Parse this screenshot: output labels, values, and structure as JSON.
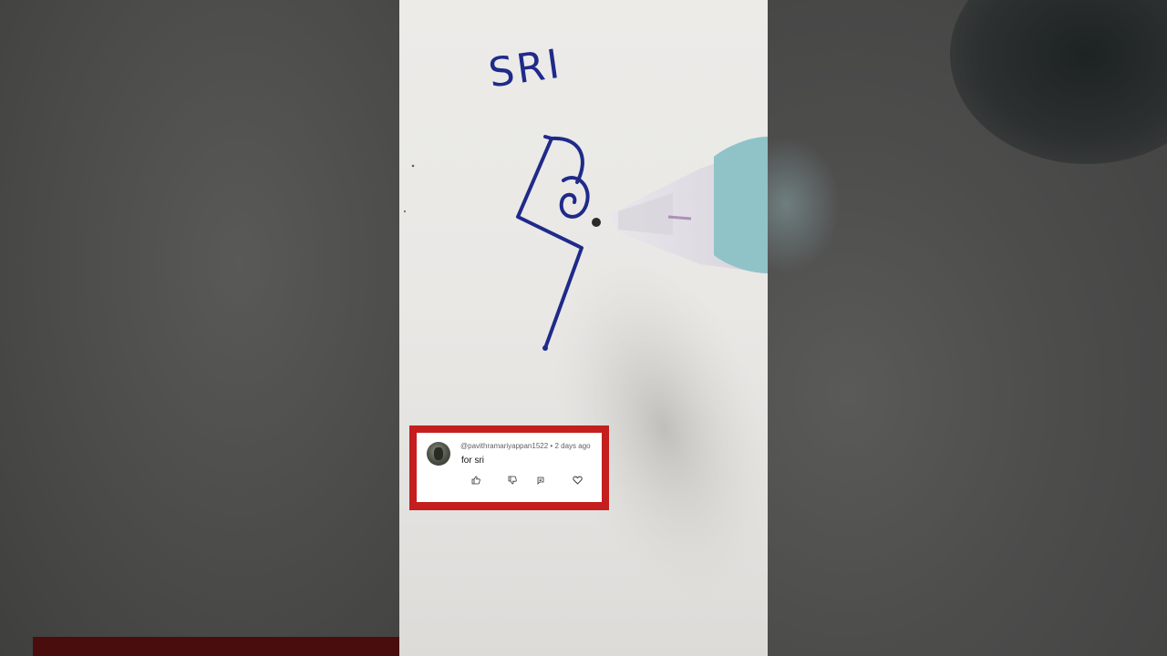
{
  "video": {
    "handwritten_text": "SRI"
  },
  "comment": {
    "username": "@pavithramariyappan1522",
    "separator": "•",
    "time_ago": "2 days ago",
    "text": "for sri",
    "actions": [
      "thumbs-up-icon",
      "thumbs-down-icon",
      "reply-icon",
      "heart-icon"
    ]
  },
  "colors": {
    "ink": "#1f2a8a",
    "frame": "#c41e1e",
    "pen_cap": "#8fc3c7"
  }
}
